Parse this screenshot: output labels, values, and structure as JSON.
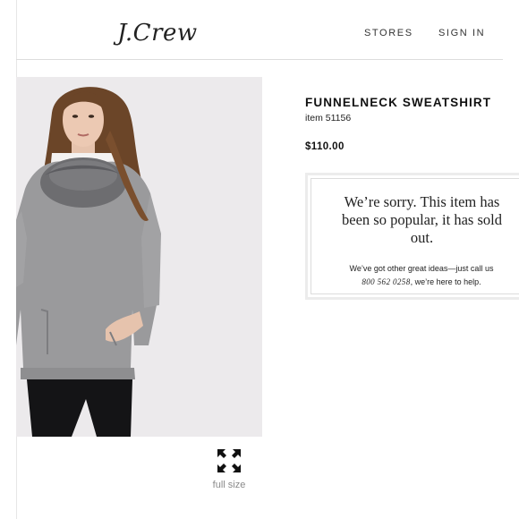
{
  "header": {
    "logo": "J.Crew",
    "nav": {
      "stores": "STORES",
      "sign_in": "SIGN IN"
    }
  },
  "product": {
    "title": "FUNNELNECK SWEATSHIRT",
    "item_number": "item 51156",
    "price": "$110.00"
  },
  "sold_out": {
    "message_line1": "We’re sorry. This item has",
    "message_line2": "been so popular, it has sold",
    "message_line3": "out.",
    "contact_prefix": "We’ve got other great ideas—just call us",
    "phone": "800 562 0258",
    "contact_suffix": ", we’re here to help."
  },
  "image": {
    "fullsize_label": "full size",
    "fullsize_icon": "expand-arrows-icon",
    "background_color": "#eceaec"
  }
}
